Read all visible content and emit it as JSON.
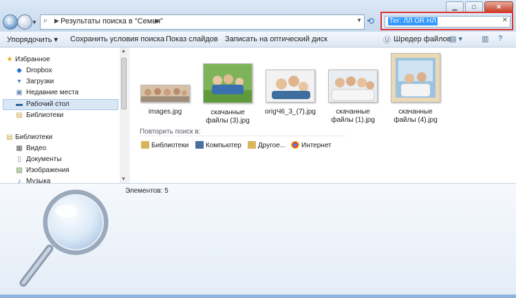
{
  "address": {
    "crumb": "Результаты поиска в \"Семья\""
  },
  "search": {
    "value": "Тег: ЛЛ OR НЛ"
  },
  "toolbar": {
    "organize": "Упорядочить",
    "save_search": "Сохранить условия поиска",
    "slideshow": "Показ слайдов",
    "burn": "Записать на оптический диск",
    "shredder": "Шредер файлов"
  },
  "sidebar": {
    "favorites": "Избранное",
    "dropbox": "Dropbox",
    "downloads": "Загрузки",
    "recent": "Недавние места",
    "desktop": "Рабочий стол",
    "libraries_fav": "Библиотеки",
    "libraries": "Библиотеки",
    "video": "Видео",
    "documents": "Документы",
    "images": "Изображения",
    "music": "Музыка"
  },
  "files": [
    {
      "name": "images.jpg"
    },
    {
      "name": "скачанные файлы (3).jpg"
    },
    {
      "name": "origЧ6_3_(7).jpg"
    },
    {
      "name": "скачанные файлы (1).jpg"
    },
    {
      "name": "скачанные файлы (4).jpg"
    }
  ],
  "search_again": {
    "label": "Повторить поиск в:",
    "libraries": "Библиотеки",
    "computer": "Компьютер",
    "other": "Другое...",
    "internet": "Интернет"
  },
  "status": {
    "count": "Элементов: 5"
  },
  "colors": {
    "highlight_border": "#e0302d",
    "selection": "#3399ff"
  }
}
